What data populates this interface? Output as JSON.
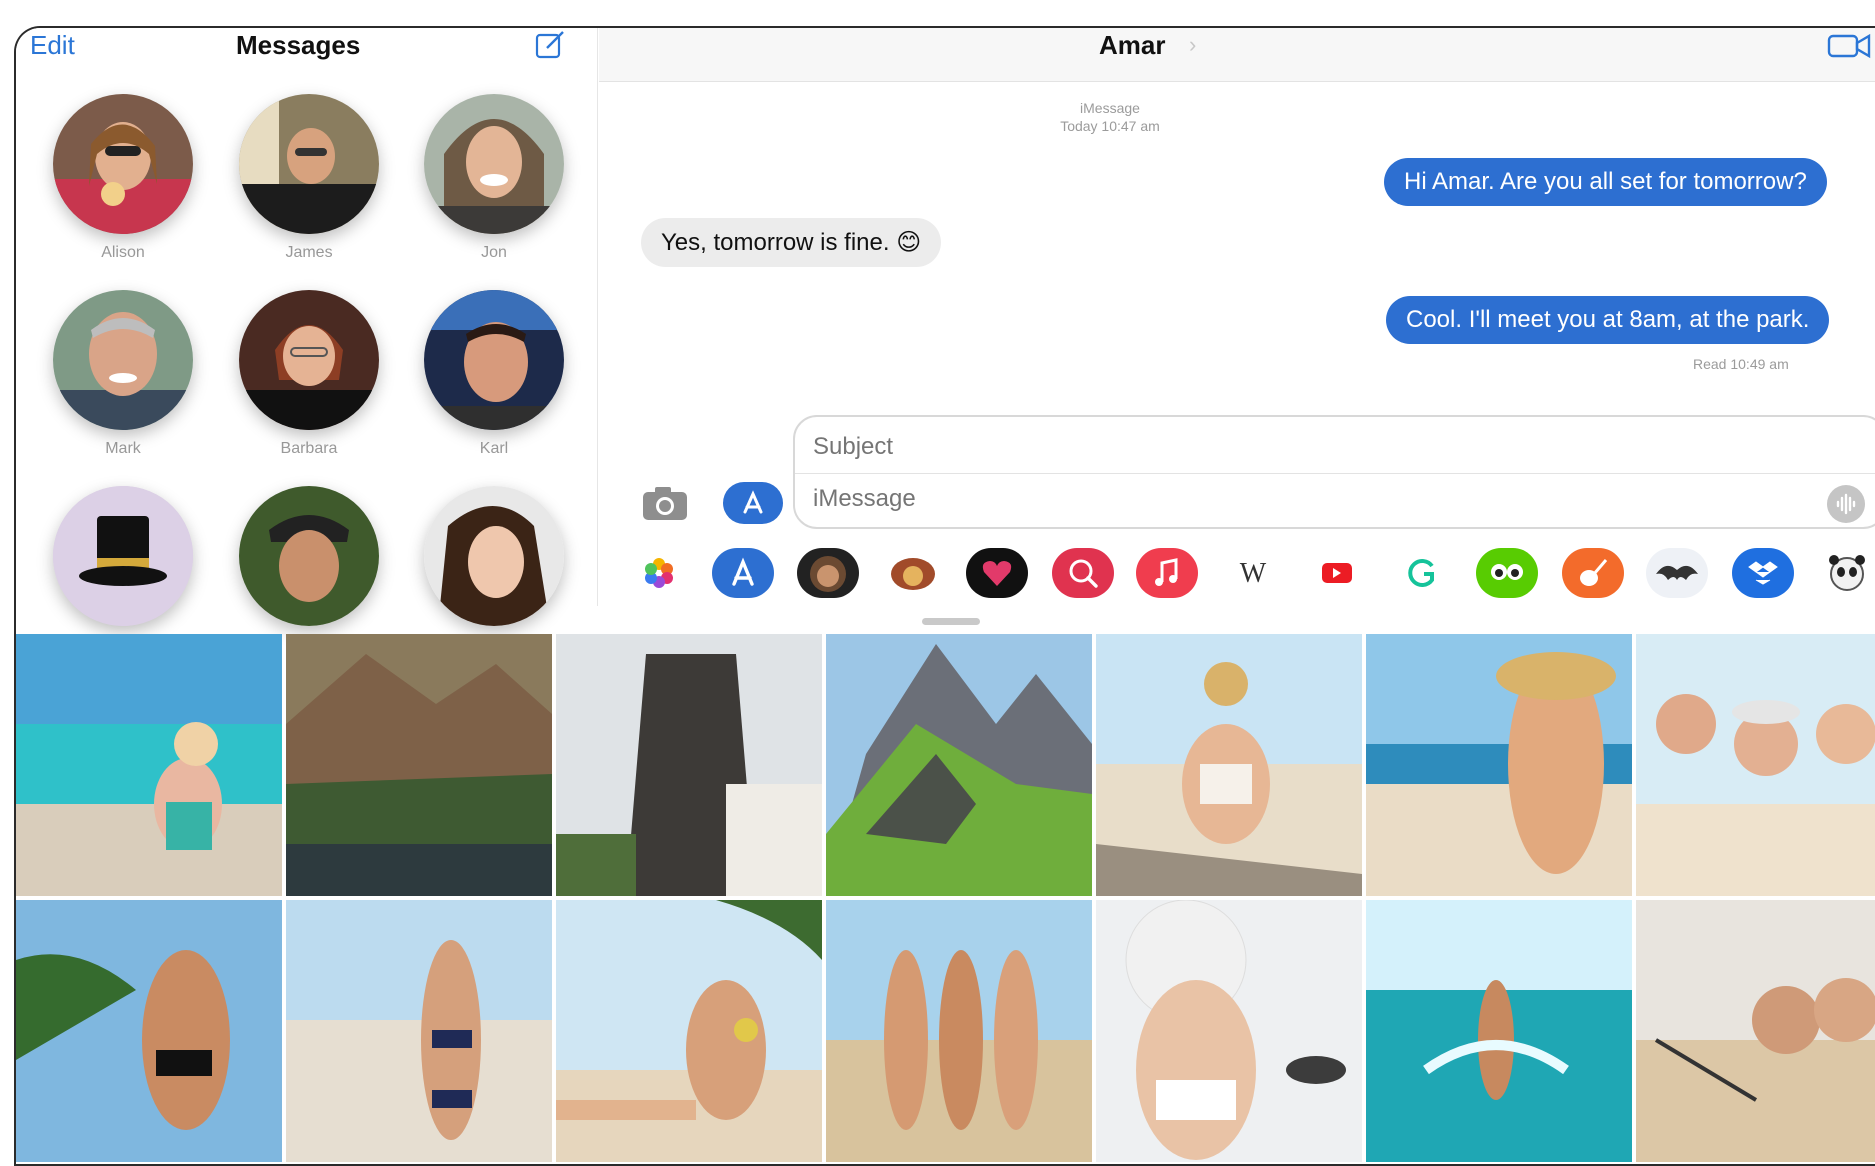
{
  "sidebar": {
    "edit_label": "Edit",
    "title": "Messages",
    "contacts": [
      {
        "name": "Alison"
      },
      {
        "name": "James"
      },
      {
        "name": "Jon"
      },
      {
        "name": "Mark"
      },
      {
        "name": "Barbara"
      },
      {
        "name": "Karl"
      },
      {
        "name": ""
      },
      {
        "name": ""
      },
      {
        "name": ""
      }
    ]
  },
  "conversation": {
    "contact_name": "Amar",
    "service_label": "iMessage",
    "timestamp": "Today 10:47 am",
    "messages": [
      {
        "direction": "out",
        "text": "Hi Amar. Are you all set for tomorrow?"
      },
      {
        "direction": "in",
        "text": "Yes, tomorrow is fine. 😊"
      },
      {
        "direction": "out",
        "text": "Cool. I'll meet you at 8am, at the park."
      }
    ],
    "read_receipt": "Read 10:49 am",
    "subject_placeholder": "Subject",
    "message_placeholder": "iMessage"
  },
  "app_strip": {
    "apps": [
      {
        "icon": "photos-icon"
      },
      {
        "icon": "app-store-icon"
      },
      {
        "icon": "memoji-icon"
      },
      {
        "icon": "animoji-icon"
      },
      {
        "icon": "digital-touch-icon"
      },
      {
        "icon": "images-search-icon"
      },
      {
        "icon": "music-icon"
      },
      {
        "icon": "wikipedia-icon",
        "label": "W"
      },
      {
        "icon": "youtube-icon"
      },
      {
        "icon": "grammarly-icon"
      },
      {
        "icon": "duolingo-icon"
      },
      {
        "icon": "garageband-icon"
      },
      {
        "icon": "bat-game-icon"
      },
      {
        "icon": "dropbox-icon"
      },
      {
        "icon": "panda-sticker-icon"
      }
    ]
  },
  "colors": {
    "accent_blue": "#2d6fd1",
    "incoming_bubble": "#ececec",
    "link_blue": "#2b76d6"
  }
}
